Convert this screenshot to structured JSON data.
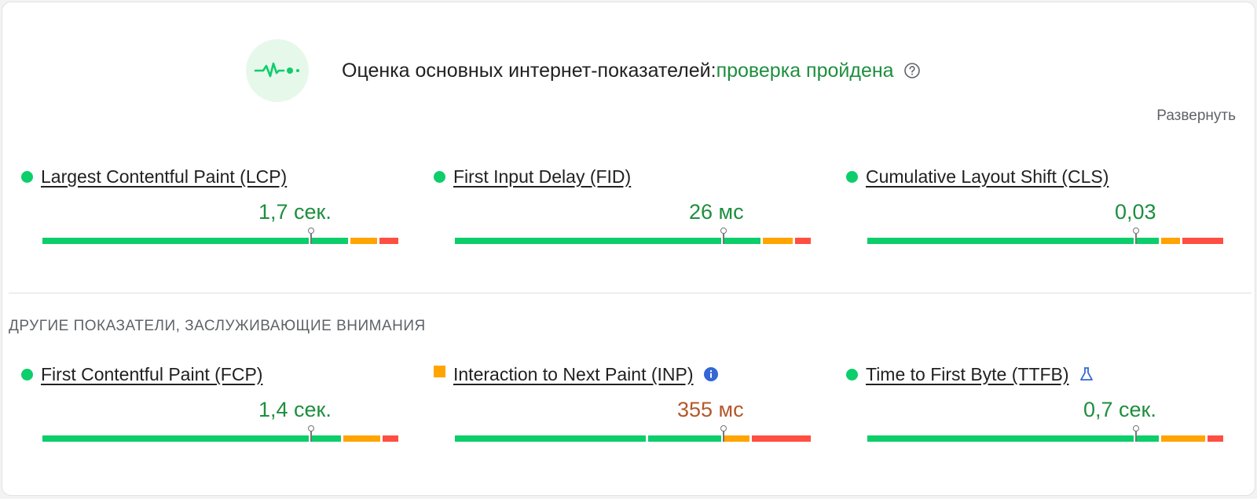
{
  "header": {
    "title": "Оценка основных интернет-показателей:",
    "status": "проверка пройдена",
    "icon": "pulse-icon",
    "help_icon": "help-circle-icon"
  },
  "expand_label": "Развернуть",
  "section_label": "ДРУГИЕ ПОКАЗАТЕЛИ, ЗАСЛУЖИВАЮЩИЕ ВНИМАНИЯ",
  "colors": {
    "good": "#0cce6b",
    "average": "#ffa400",
    "poor": "#ff4e42",
    "good_text": "#1e8e3e",
    "average_text": "#b5572b"
  },
  "core_metrics": [
    {
      "name": "Largest Contentful Paint (LCP)",
      "value": "1,7 сек.",
      "rating": "good",
      "distribution": [
        0.75,
        0.11,
        0.08,
        0.06
      ],
      "marker": 0.75
    },
    {
      "name": "First Input Delay (FID)",
      "value": "26 мс",
      "rating": "good",
      "distribution": [
        0.75,
        0.11,
        0.09,
        0.05
      ],
      "marker": 0.75
    },
    {
      "name": "Cumulative Layout Shift (CLS)",
      "value": "0,03",
      "rating": "good",
      "distribution": [
        0.75,
        0.07,
        0.06,
        0.12
      ],
      "marker": 0.75
    }
  ],
  "other_metrics": [
    {
      "name": "First Contentful Paint (FCP)",
      "value": "1,4 сек.",
      "rating": "good",
      "distribution": [
        0.75,
        0.09,
        0.11,
        0.05
      ],
      "marker": 0.75,
      "extra_icon": ""
    },
    {
      "name": "Interaction to Next Paint (INP)",
      "value": "355 мс",
      "rating": "average",
      "distribution": [
        0.54,
        0.21,
        0.08,
        0.17
      ],
      "marker": 0.75,
      "extra_icon": "info-icon"
    },
    {
      "name": "Time to First Byte (TTFB)",
      "value": "0,7 сек.",
      "rating": "good",
      "distribution": [
        0.75,
        0.07,
        0.13,
        0.05
      ],
      "marker": 0.75,
      "extra_icon": "experimental-flask-icon"
    }
  ]
}
